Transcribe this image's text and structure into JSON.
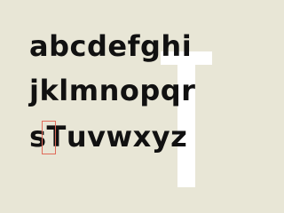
{
  "specimen": {
    "rows": [
      "abcdefghi",
      "jklmnopqr",
      "stuvwxyz"
    ],
    "highlighted_glyph": "T",
    "background_letter": "T"
  },
  "colors": {
    "background": "#e8e6d6",
    "text": "#111111",
    "background_letter": "#ffffff",
    "highlight_border": "#e06b5a"
  }
}
